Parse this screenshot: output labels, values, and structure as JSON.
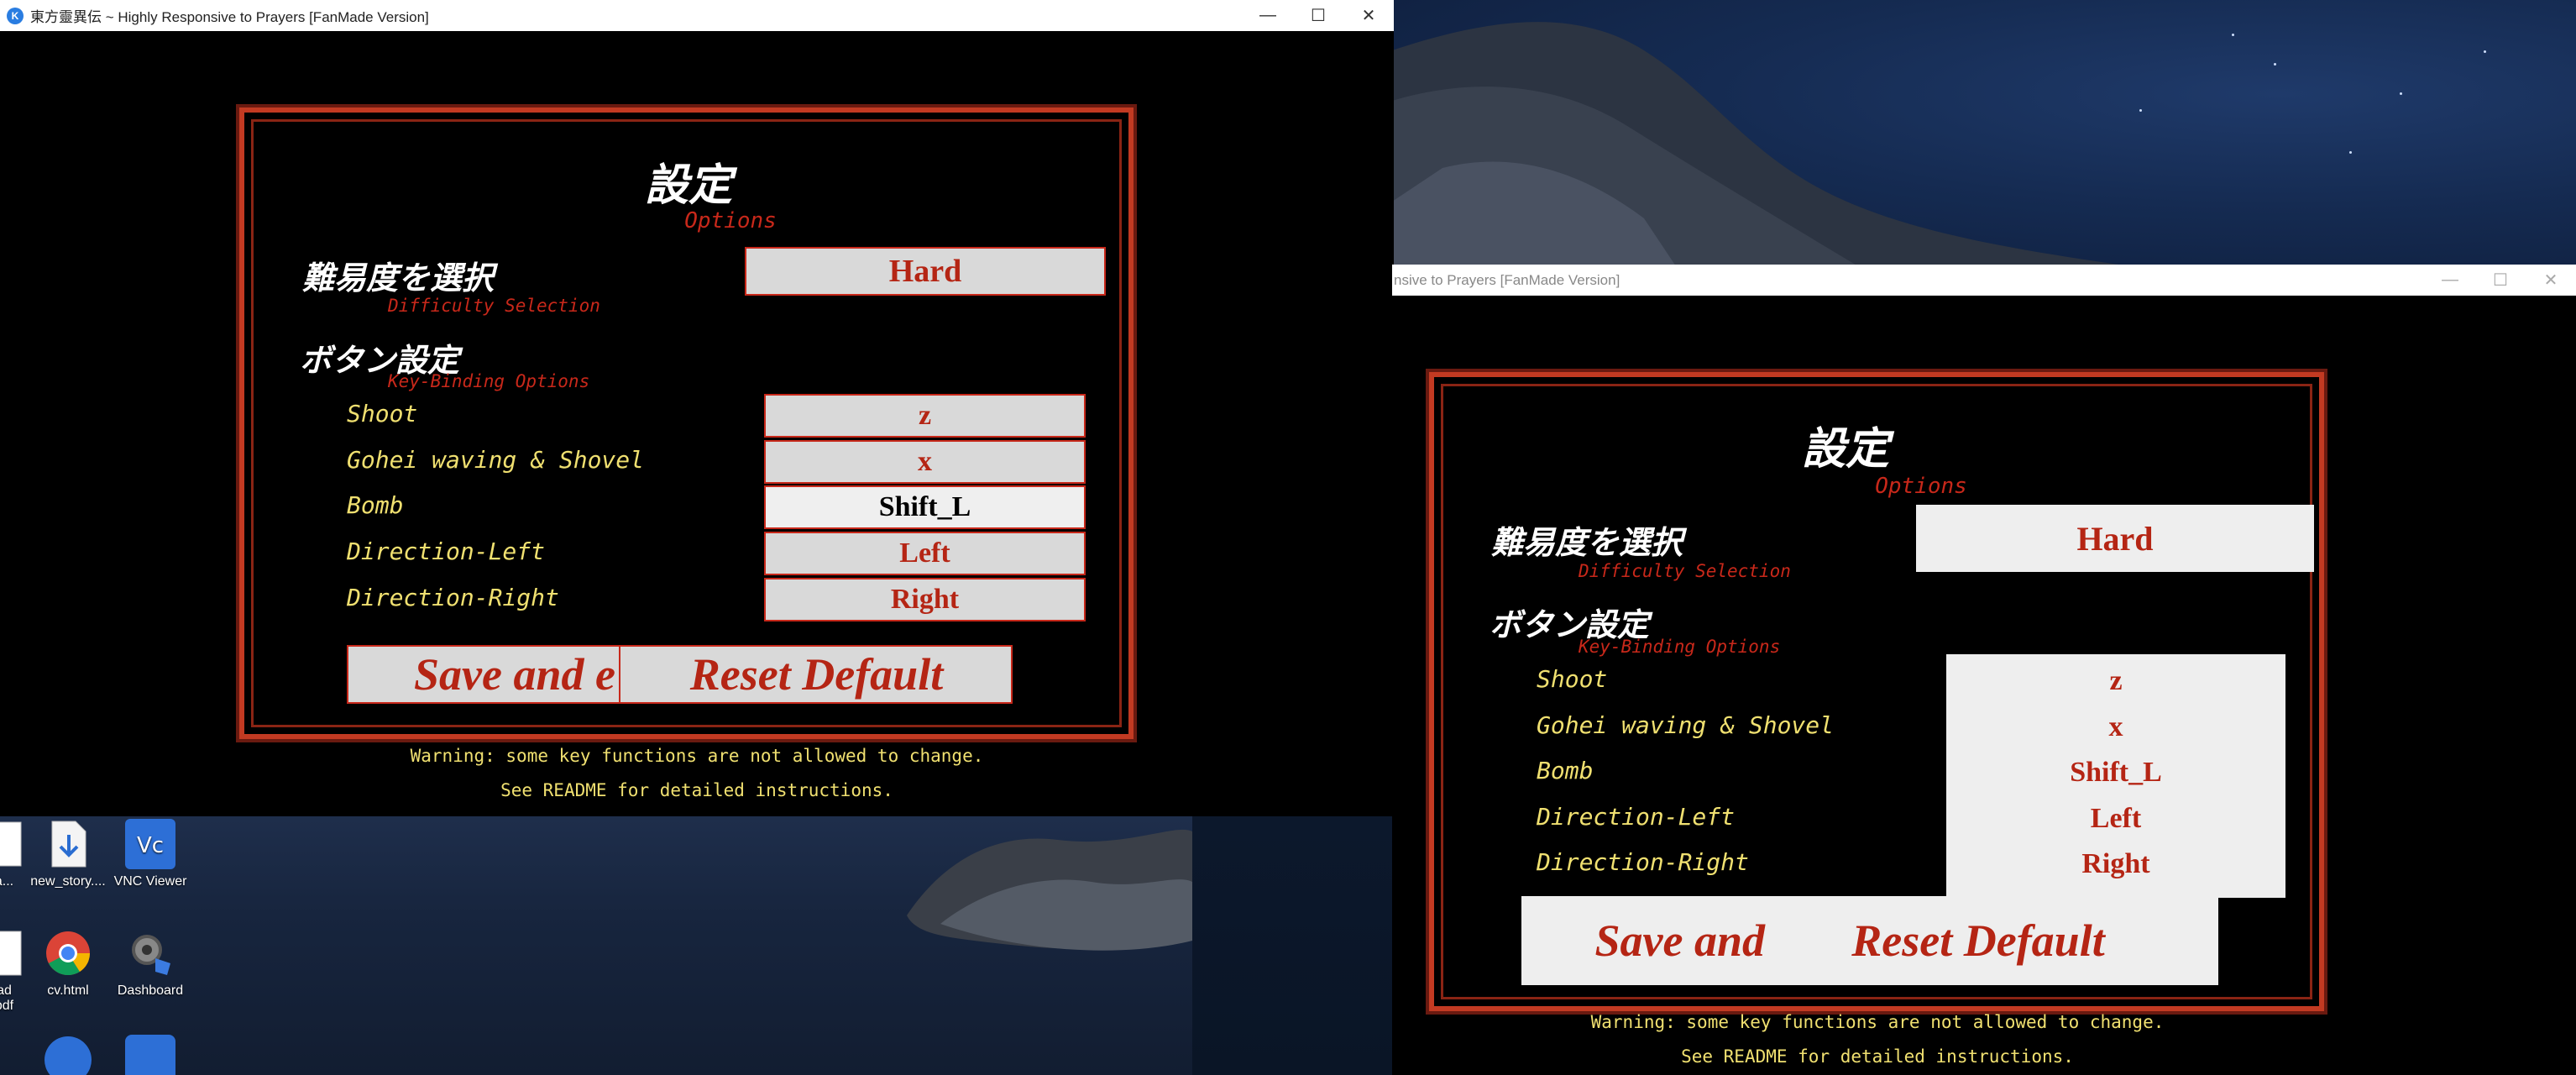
{
  "window1": {
    "title": "東方靈異伝 ~ Highly Responsive to Prayers [FanMade Version]",
    "controls": {
      "minimize": "—",
      "maximize": "☐",
      "close": "✕"
    }
  },
  "window2": {
    "title": "nsive to Prayers [FanMade Version]",
    "controls": {
      "minimize": "—",
      "maximize": "☐",
      "close": "✕"
    }
  },
  "options": {
    "title": "設定",
    "subtitle": "Options",
    "difficulty_heading": "難易度を選択",
    "difficulty_sub": "Difficulty Selection",
    "difficulty_value": "Hard",
    "keybind_heading": "ボタン設定",
    "keybind_sub": "Key-Binding Options",
    "bindings": [
      {
        "label": "Shoot",
        "value": "z"
      },
      {
        "label": "Gohei waving & Shovel",
        "value": "x"
      },
      {
        "label": "Bomb",
        "value": "Shift_L"
      },
      {
        "label": "Direction-Left",
        "value": "Left"
      },
      {
        "label": "Direction-Right",
        "value": "Right"
      }
    ],
    "save_button": "Save and e",
    "save_button_full": "Save and",
    "reset_button": "Reset Default",
    "warning_1": "Warning: some key functions are not allowed to change.",
    "warning_2": "See README for detailed instructions."
  },
  "desktop_icons": [
    {
      "name": "partial-icon-1",
      "label": "a..."
    },
    {
      "name": "new-story",
      "label": "new_story...."
    },
    {
      "name": "vnc-viewer",
      "label": "VNC Viewer"
    },
    {
      "name": "partial-icon-2",
      "label": "ad\npdf"
    },
    {
      "name": "cv-html",
      "label": "cv.html"
    },
    {
      "name": "dashboard",
      "label": "Dashboard"
    }
  ],
  "colors": {
    "panel_border": "#c23a22",
    "accent_red": "#b52514",
    "key_yellow": "#f0e070"
  }
}
